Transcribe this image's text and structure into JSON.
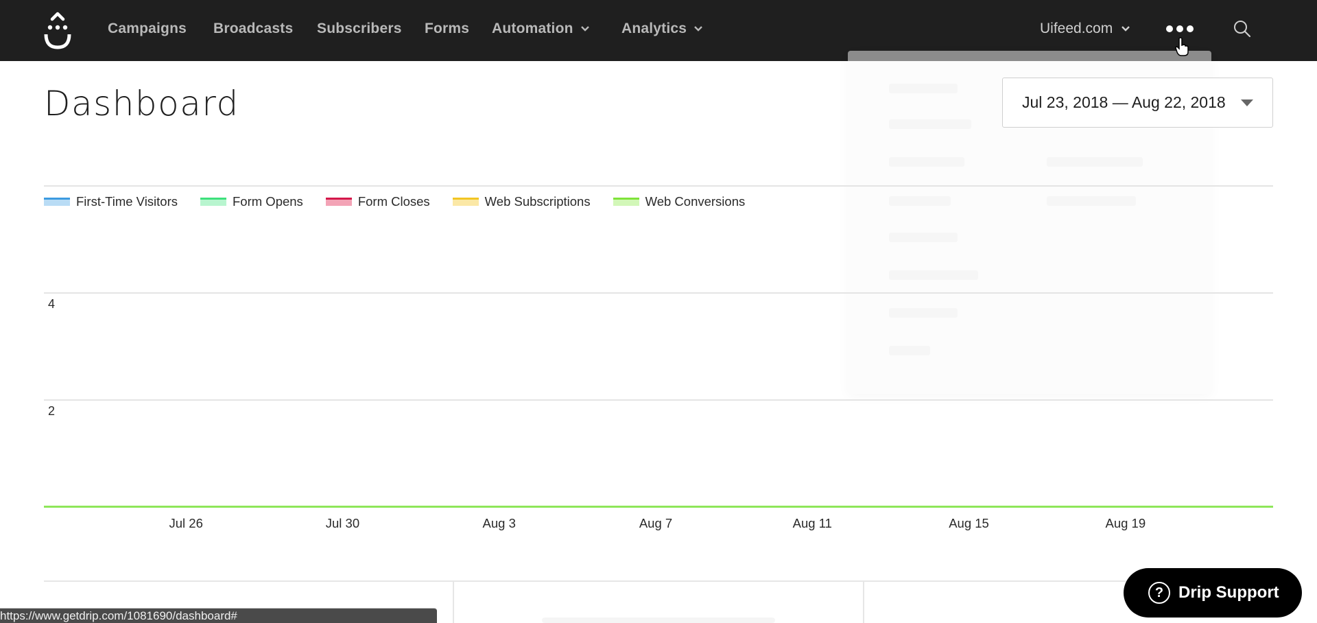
{
  "nav": {
    "items": [
      {
        "label": "Campaigns",
        "has_dropdown": false
      },
      {
        "label": "Broadcasts",
        "has_dropdown": false
      },
      {
        "label": "Subscribers",
        "has_dropdown": false
      },
      {
        "label": "Forms",
        "has_dropdown": false
      },
      {
        "label": "Automation",
        "has_dropdown": true
      },
      {
        "label": "Analytics",
        "has_dropdown": true
      }
    ],
    "account_label": "Uifeed.com",
    "more_icon": "ellipsis-icon",
    "search_icon": "search-icon",
    "logo_icon": "drip-logo-icon"
  },
  "page": {
    "title": "Dashboard",
    "date_range": "Jul 23, 2018 — Aug 22, 2018"
  },
  "colors": {
    "nav_bg": "#1f1f1f",
    "nav_text": "#b9b9b9",
    "first_time_visitors": "#3d9be0",
    "form_opens": "#3ee07c",
    "form_closes": "#d4184a",
    "web_subscriptions": "#f2c523",
    "web_conversions": "#7fe33a"
  },
  "chart_data": {
    "type": "line",
    "title": "",
    "xlabel": "",
    "ylabel": "",
    "legend_position": "top-left",
    "grid": true,
    "x_tick_labels": [
      "Jul 26",
      "Jul 30",
      "Aug 3",
      "Aug 7",
      "Aug 11",
      "Aug 15",
      "Aug 19"
    ],
    "y_tick_labels": [
      "2",
      "4"
    ],
    "ylim": [
      0,
      6
    ],
    "x_range": [
      "Jul 23, 2018",
      "Aug 22, 2018"
    ],
    "series": [
      {
        "name": "First-Time Visitors",
        "values": [
          0
        ]
      },
      {
        "name": "Form Opens",
        "values": [
          0
        ]
      },
      {
        "name": "Form Closes",
        "values": [
          0
        ]
      },
      {
        "name": "Web Subscriptions",
        "values": [
          0
        ]
      },
      {
        "name": "Web Conversions",
        "values": [
          0
        ]
      }
    ],
    "note": "all series flat at 0 across the date range"
  },
  "support_button": {
    "label": "Drip Support",
    "icon": "question-circle-icon"
  },
  "status_bar": {
    "url": "https://www.getdrip.com/1081690/dashboard#"
  }
}
